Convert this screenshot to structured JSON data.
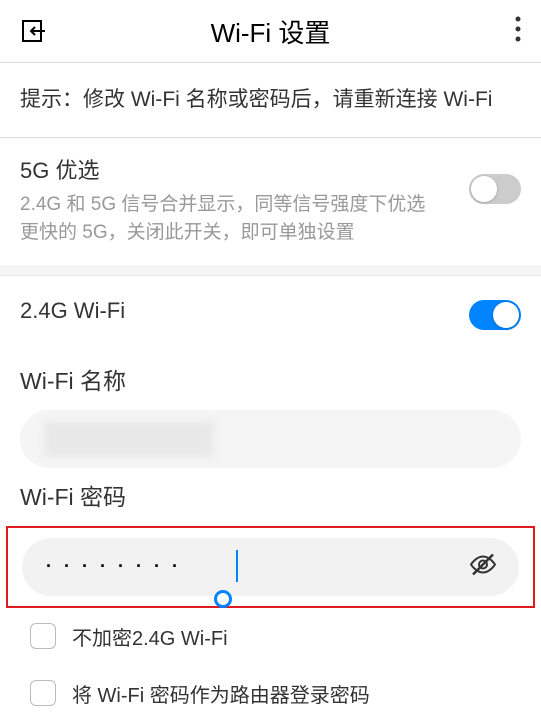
{
  "header": {
    "title": "Wi-Fi 设置"
  },
  "hint": {
    "text": "提示：修改 Wi-Fi 名称或密码后，请重新连接 Wi-Fi"
  },
  "prefer5g": {
    "title": "5G 优选",
    "desc": "2.4G 和 5G 信号合并显示，同等信号强度下优选更快的 5G，关闭此开关，即可单独设置",
    "enabled": false
  },
  "wifi24g": {
    "title": "2.4G Wi-Fi",
    "enabled": true
  },
  "wifiName": {
    "label": "Wi-Fi 名称",
    "value": ""
  },
  "wifiPassword": {
    "label": "Wi-Fi 密码",
    "masked": "········"
  },
  "checkboxes": {
    "noEncrypt": "不加密2.4G Wi-Fi",
    "useAsRouterPwd": "将 Wi-Fi 密码作为路由器登录密码"
  }
}
